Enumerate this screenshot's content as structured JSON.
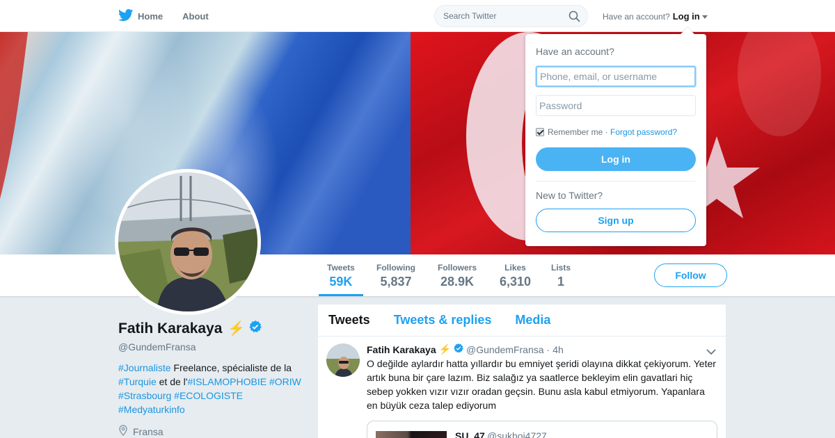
{
  "nav": {
    "home_label": "Home",
    "about_label": "About",
    "search_placeholder": "Search Twitter",
    "account_prompt": "Have an account?",
    "login_label": "Log in"
  },
  "profile": {
    "name": "Fatih Karakaya",
    "name_emoji": "⚡",
    "handle": "@GundemFransa",
    "bio": [
      {
        "text": "#Journaliste",
        "tag": true
      },
      {
        "text": " Freelance, spécialiste de la ",
        "tag": false
      },
      {
        "text": "#Turquie",
        "tag": true
      },
      {
        "text": " et de l'",
        "tag": false
      },
      {
        "text": "#ISLAMOPHOBIE",
        "tag": true
      },
      {
        "text": " ",
        "tag": false
      },
      {
        "text": "#ORIW",
        "tag": true
      },
      {
        "text": " ",
        "tag": false
      },
      {
        "text": "#Strasbourg",
        "tag": true
      },
      {
        "text": " ",
        "tag": false
      },
      {
        "text": "#ECOLOGISTE",
        "tag": true
      },
      {
        "text": " ",
        "tag": false
      },
      {
        "text": "#Medyaturkinfo",
        "tag": true
      }
    ],
    "location": "Fransa"
  },
  "stats": [
    {
      "label": "Tweets",
      "value": "59K",
      "active": true
    },
    {
      "label": "Following",
      "value": "5,837",
      "active": false
    },
    {
      "label": "Followers",
      "value": "28.9K",
      "active": false
    },
    {
      "label": "Likes",
      "value": "6,310",
      "active": false
    },
    {
      "label": "Lists",
      "value": "1",
      "active": false
    }
  ],
  "follow_label": "Follow",
  "tabs": [
    "Tweets",
    "Tweets & replies",
    "Media"
  ],
  "tweet": {
    "name": "Fatih Karakaya",
    "emoji": "⚡",
    "handle": "@GundemFransa",
    "dot": "·",
    "time": "4h",
    "text": "O değilde aylardır hatta yıllardır bu emniyet şeridi olayına dikkat çekiyorum. Yeter artık buna bir çare lazım. Biz salağız ya saatlerce bekleyim elin gavatlari hiç sebep yokken vızır vızır oradan geçsin. Bunu asla kabul etmiyorum. Yapanlara en büyük ceza talep ediyorum",
    "quote": {
      "name": "SU_47",
      "handle": "@sukhoi4727"
    }
  },
  "login_dropdown": {
    "title": "Have an account?",
    "username_placeholder": "Phone, email, or username",
    "password_placeholder": "Password",
    "remember_label": "Remember me",
    "separator": " · ",
    "forgot_label": "Forgot password?",
    "login_button": "Log in",
    "new_prompt": "New to Twitter?",
    "signup_button": "Sign up"
  },
  "colors": {
    "accent": "#1da1f2",
    "login_button_bg": "#4ab3f4",
    "link": "#1b95e0",
    "background": "#e6ecf0"
  }
}
